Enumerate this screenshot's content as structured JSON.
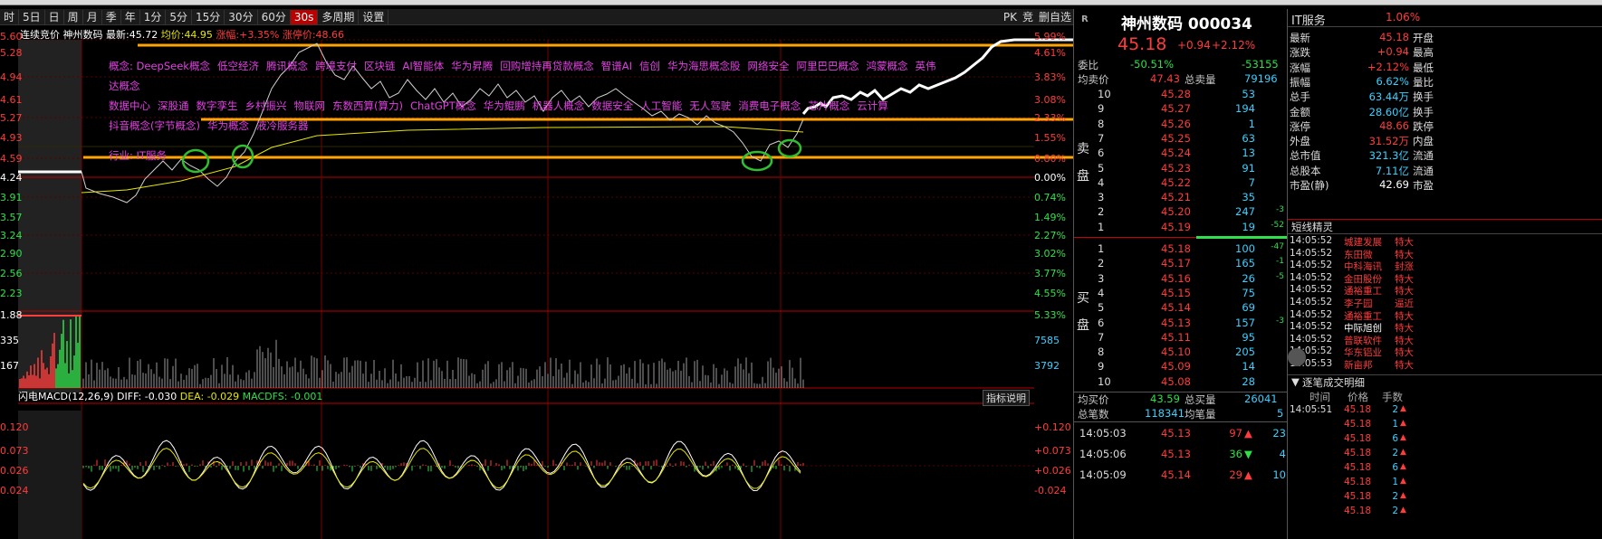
{
  "toolbar": {
    "periods": [
      "时",
      "5日",
      "日",
      "周",
      "月",
      "季",
      "年",
      "1分",
      "5分",
      "15分",
      "30分",
      "60分",
      "30s",
      "多周期",
      "设置"
    ],
    "selected": "30s",
    "right_labels": [
      "PK",
      "竞",
      "删自选"
    ]
  },
  "header": {
    "auction_label": "连续竞价",
    "stock_name": "神州数码",
    "latest_label": "最新:",
    "latest_value": "45.72",
    "avg_label": "均价:",
    "avg_value": "44.95",
    "change_label": "涨幅:",
    "change_value": "+3.35%",
    "limit_label": "涨停价:",
    "limit_value": "48.66"
  },
  "price_axis_left": [
    "5.60",
    "5.28",
    "4.94",
    "4.61",
    "5.27",
    "4.93",
    "4.59",
    "4.24",
    "3.91",
    "3.57",
    "3.24",
    "2.90",
    "2.56",
    "2.23",
    "1.88",
    "335",
    "167"
  ],
  "pct_axis_right": [
    "5.99%",
    "4.61%",
    "3.83%",
    "3.08%",
    "2.33%",
    "1.55%",
    "0.80%",
    "0.00%",
    "0.74%",
    "1.49%",
    "2.27%",
    "3.02%",
    "3.77%",
    "4.55%",
    "5.33%",
    "7585",
    "3792"
  ],
  "concepts_line1": [
    "概念: DeepSeek概念",
    "低空经济",
    "腾讯概念",
    "跨境支付",
    "区块链",
    "AI智能体",
    "华为昇腾",
    "回购增持再贷款概念",
    "智谱AI",
    "信创",
    "华为海思概念股",
    "网络安全",
    "阿里巴巴概念",
    "鸿蒙概念",
    "英伟达概念"
  ],
  "concepts_line2": [
    "数据中心",
    "深股通",
    "数字孪生",
    "乡村振兴",
    "物联网",
    "东数西算(算力)",
    "ChatGPT概念",
    "华为鲲鹏",
    "机器人概念",
    "数据安全",
    "人工智能",
    "无人驾驶",
    "消费电子概念",
    "芯片概念",
    "云计算"
  ],
  "concepts_line3": [
    "抖音概念(字节概念)",
    "华为概念",
    "液冷服务器"
  ],
  "industry": "行业: IT服务",
  "macd": {
    "label": "闪电MACD(12,26,9)",
    "diff": "DIFF: -0.030",
    "dea": "DEA: -0.029",
    "macdfs": "MACDFS: -0.001",
    "button": "指标说明",
    "axis": [
      "0.120",
      "0.073",
      "0.026",
      "0.024"
    ],
    "axis_right": [
      "+0.120",
      "+0.073",
      "+0.026",
      "-0.024"
    ]
  },
  "quote": {
    "title": "神州数码 000034",
    "price": "45.18",
    "change": "+0.94",
    "change_pct": "+2.12%",
    "webi_label": "委比",
    "webi_value": "-50.51%",
    "webi_diff": "-53155",
    "avg_sell_label": "均卖价",
    "avg_sell_value": "47.43",
    "total_sell_label": "总卖量",
    "total_sell_value": "79196",
    "sell_label": "卖盘",
    "buy_label": "买盘",
    "sells": [
      {
        "lvl": "10",
        "price": "45.28",
        "vol": "53",
        "chg": ""
      },
      {
        "lvl": "9",
        "price": "45.27",
        "vol": "194",
        "chg": ""
      },
      {
        "lvl": "8",
        "price": "45.26",
        "vol": "1",
        "chg": ""
      },
      {
        "lvl": "7",
        "price": "45.25",
        "vol": "63",
        "chg": ""
      },
      {
        "lvl": "6",
        "price": "45.24",
        "vol": "13",
        "chg": ""
      },
      {
        "lvl": "5",
        "price": "45.23",
        "vol": "91",
        "chg": ""
      },
      {
        "lvl": "4",
        "price": "45.22",
        "vol": "7",
        "chg": ""
      },
      {
        "lvl": "3",
        "price": "45.21",
        "vol": "35",
        "chg": ""
      },
      {
        "lvl": "2",
        "price": "45.20",
        "vol": "247",
        "chg": "-3"
      },
      {
        "lvl": "1",
        "price": "45.19",
        "vol": "19",
        "chg": "-52"
      }
    ],
    "buys": [
      {
        "lvl": "1",
        "price": "45.18",
        "vol": "100",
        "chg": "-47"
      },
      {
        "lvl": "2",
        "price": "45.17",
        "vol": "165",
        "chg": "-1"
      },
      {
        "lvl": "3",
        "price": "45.16",
        "vol": "26",
        "chg": "-5"
      },
      {
        "lvl": "4",
        "price": "45.15",
        "vol": "75",
        "chg": ""
      },
      {
        "lvl": "5",
        "price": "45.14",
        "vol": "69",
        "chg": ""
      },
      {
        "lvl": "6",
        "price": "45.13",
        "vol": "157",
        "chg": "-3"
      },
      {
        "lvl": "7",
        "price": "45.11",
        "vol": "95",
        "chg": ""
      },
      {
        "lvl": "8",
        "price": "45.10",
        "vol": "205",
        "chg": ""
      },
      {
        "lvl": "9",
        "price": "45.09",
        "vol": "14",
        "chg": ""
      },
      {
        "lvl": "10",
        "price": "45.08",
        "vol": "28",
        "chg": ""
      }
    ],
    "avg_buy_label": "均买价",
    "avg_buy_value": "43.59",
    "total_buy_label": "总买量",
    "total_buy_value": "26041",
    "total_trades_label": "总笔数",
    "total_trades_value": "118341",
    "avg_trade_label": "均笔量",
    "avg_trade_value": "5",
    "ticks": [
      {
        "time": "14:05:03",
        "price": "45.13",
        "vol": "97",
        "dir": "up",
        "n": "23"
      },
      {
        "time": "14:05:06",
        "price": "45.13",
        "vol": "36",
        "dir": "down",
        "n": "4"
      },
      {
        "time": "14:05:09",
        "price": "45.14",
        "vol": "29",
        "dir": "up",
        "n": "10"
      }
    ]
  },
  "stats": {
    "sector": "IT服务",
    "sector_pct": "1.06%",
    "items": [
      {
        "k": "最新",
        "v": "45.18",
        "c": "red",
        "k2": "开盘"
      },
      {
        "k": "涨跌",
        "v": "+0.94",
        "c": "red",
        "k2": "最高"
      },
      {
        "k": "涨幅",
        "v": "+2.12%",
        "c": "red",
        "k2": "最低"
      },
      {
        "k": "振幅",
        "v": "6.62%",
        "c": "cy",
        "k2": "量比"
      },
      {
        "k": "总手",
        "v": "63.44万",
        "c": "cy",
        "k2": "换手"
      },
      {
        "k": "金额",
        "v": "28.60亿",
        "c": "cy",
        "k2": "换手"
      },
      {
        "k": "涨停",
        "v": "48.66",
        "c": "red",
        "k2": "跌停"
      },
      {
        "k": "外盘",
        "v": "31.52万",
        "c": "red",
        "k2": "内盘"
      },
      {
        "k": "总市值",
        "v": "321.3亿",
        "c": "cy",
        "k2": "流通"
      },
      {
        "k": "总股本",
        "v": "7.11亿",
        "c": "cy",
        "k2": "流通"
      },
      {
        "k": "市盈(静)",
        "v": "42.69",
        "c": "wht",
        "k2": "市盈"
      }
    ],
    "elves_title": "短线精灵",
    "elves": [
      {
        "time": "14:05:52",
        "name": "城建发展",
        "tag": "特大"
      },
      {
        "time": "14:05:52",
        "name": "东田微",
        "tag": "特大"
      },
      {
        "time": "14:05:52",
        "name": "中科海讯",
        "tag": "封涨"
      },
      {
        "time": "14:05:52",
        "name": "金田股份",
        "tag": "特大"
      },
      {
        "time": "14:05:52",
        "name": "通裕重工",
        "tag": "特大"
      },
      {
        "time": "14:05:52",
        "name": "李子园",
        "tag": "逼近"
      },
      {
        "time": "14:05:52",
        "name": "通裕重工",
        "tag": "特大"
      },
      {
        "time": "14:05:52",
        "name": "中际旭创",
        "tag": "特大"
      },
      {
        "time": "14:05:52",
        "name": "普联软件",
        "tag": "特大"
      },
      {
        "time": "14:05:52",
        "name": "华东铝业",
        "tag": "特大"
      },
      {
        "time": "14:05:53",
        "name": "新亩邦",
        "tag": "特大"
      }
    ],
    "detail_title": "逐笔成交明细",
    "detail_headers": [
      "时间",
      "价格",
      "手数"
    ],
    "detail_rows": [
      {
        "time": "14:05:51",
        "price": "45.18",
        "n": "2"
      },
      {
        "time": "",
        "price": "45.18",
        "n": "1"
      },
      {
        "time": "",
        "price": "45.18",
        "n": "6"
      },
      {
        "time": "",
        "price": "45.18",
        "n": "2"
      },
      {
        "time": "",
        "price": "45.18",
        "n": "6"
      },
      {
        "time": "",
        "price": "45.18",
        "n": "1"
      },
      {
        "time": "",
        "price": "45.18",
        "n": "2"
      },
      {
        "time": "",
        "price": "45.18",
        "n": "2"
      }
    ]
  },
  "colors": {
    "up": "#ff3c3c",
    "down": "#2ee04a",
    "accent": "#e6e600",
    "orange": "#ffa500"
  }
}
